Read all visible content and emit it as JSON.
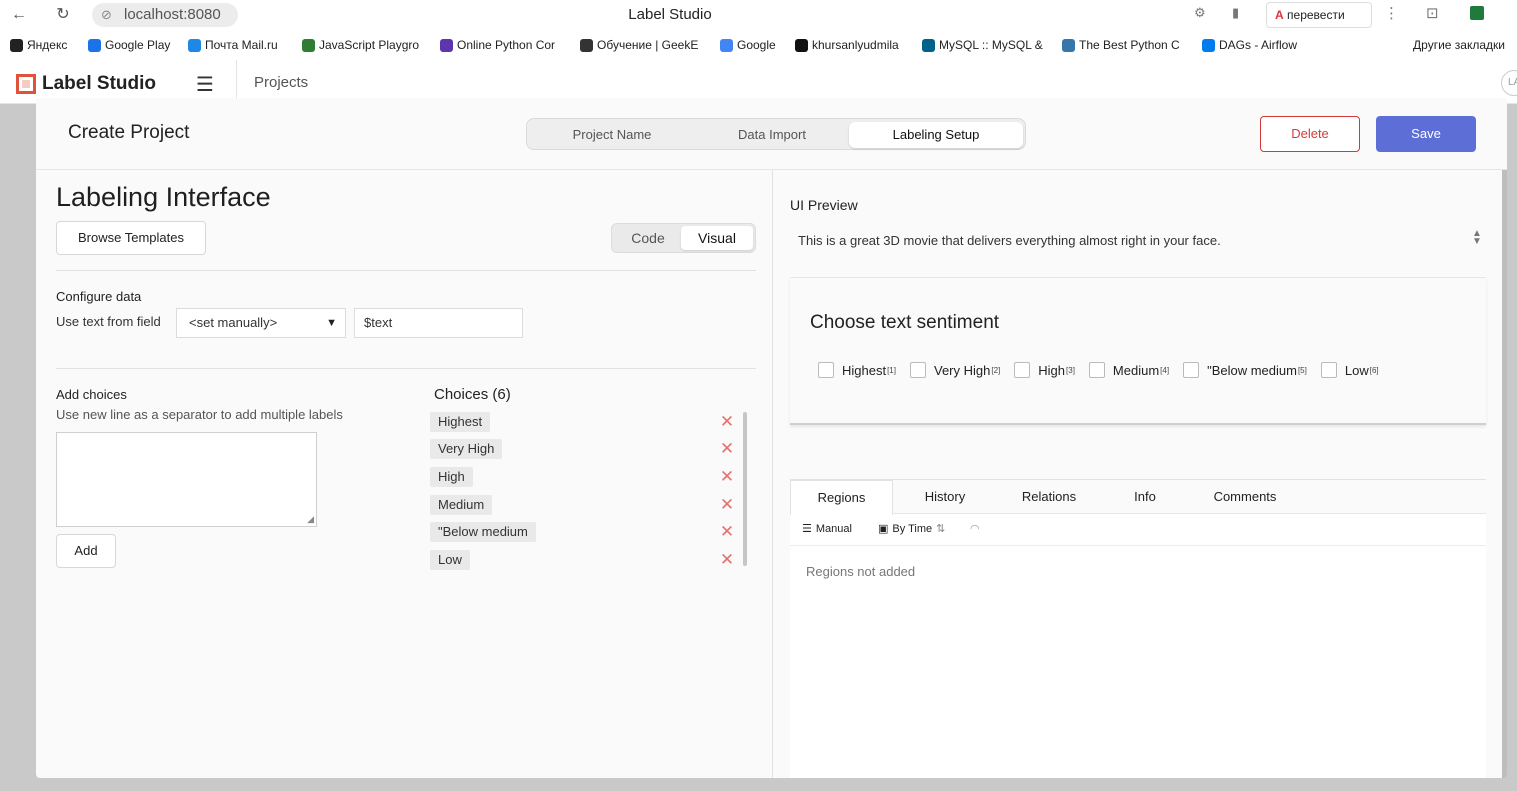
{
  "browser": {
    "back": "←",
    "reload": "↻",
    "url": "localhost:8080",
    "tab_title": "Label Studio",
    "translate": "перевести",
    "bookmarks": [
      {
        "label": "Яндекс",
        "icon": "plus-circle-icon",
        "color": "#222222"
      },
      {
        "label": "Google Play",
        "icon": "play-icon",
        "color": "#1a73e8"
      },
      {
        "label": "Почта Mail.ru",
        "icon": "mail-icon",
        "color": "#1e88e5"
      },
      {
        "label": "JavaScript Playgro",
        "icon": "code-icon",
        "color": "#2e7d32"
      },
      {
        "label": "Online Python Cor",
        "icon": "bolt-icon",
        "color": "#5e35b1"
      },
      {
        "label": "Обучение | GeekE",
        "icon": "gear-icon",
        "color": "#333333"
      },
      {
        "label": "Google",
        "icon": "google-icon",
        "color": "#4285f4"
      },
      {
        "label": "khursanlyudmila",
        "icon": "github-icon",
        "color": "#111111"
      },
      {
        "label": "MySQL :: MySQL &",
        "icon": "mysql-icon",
        "color": "#00618a"
      },
      {
        "label": "The Best Python C",
        "icon": "python-icon",
        "color": "#3776ab"
      },
      {
        "label": "DAGs - Airflow",
        "icon": "airflow-icon",
        "color": "#017cee"
      }
    ],
    "other_bookmarks": "Другие закладки"
  },
  "app": {
    "brand": "Label Studio",
    "nav_projects": "Projects",
    "avatar": "LA"
  },
  "modal": {
    "title": "Create Project",
    "steps": [
      "Project Name",
      "Data Import",
      "Labeling Setup"
    ],
    "active_step": "Labeling Setup",
    "delete_label": "Delete",
    "save_label": "Save"
  },
  "left": {
    "title": "Labeling Interface",
    "browse_templates": "Browse Templates",
    "view_toggle": [
      "Code",
      "Visual"
    ],
    "configure_data": "Configure data",
    "use_text_from": "Use text from field",
    "field_select": "<set manually>",
    "field_value": "$text",
    "add_choices": "Add choices",
    "add_choices_hint": "Use new line as a separator to add multiple labels",
    "add_button": "Add",
    "choices_header": "Choices (6)",
    "choices": [
      "Highest",
      "Very High",
      "High",
      "Medium",
      "\"Below medium",
      "Low"
    ],
    "delete_glyph": "✕"
  },
  "right": {
    "ui_preview": "UI Preview",
    "preview_text": "This is a great 3D movie that delivers everything almost right in your face.",
    "card_title": "Choose text sentiment",
    "options": [
      {
        "label": "Highest",
        "key": "[1]"
      },
      {
        "label": "Very High",
        "key": "[2]"
      },
      {
        "label": "High",
        "key": "[3]"
      },
      {
        "label": "Medium",
        "key": "[4]"
      },
      {
        "label": "\"Below medium",
        "key": "[5]"
      },
      {
        "label": "Low",
        "key": "[6]"
      }
    ],
    "tabs": [
      "Regions",
      "History",
      "Relations",
      "Info",
      "Comments"
    ],
    "active_tab": "Regions",
    "tool_manual": "Manual",
    "tool_by_time": "By Time",
    "empty": "Regions not added"
  },
  "colors": {
    "accent": "#5d6ed6",
    "danger": "#d43a3a",
    "delete_x": "#e86f6f",
    "logo": "#e0533a"
  }
}
